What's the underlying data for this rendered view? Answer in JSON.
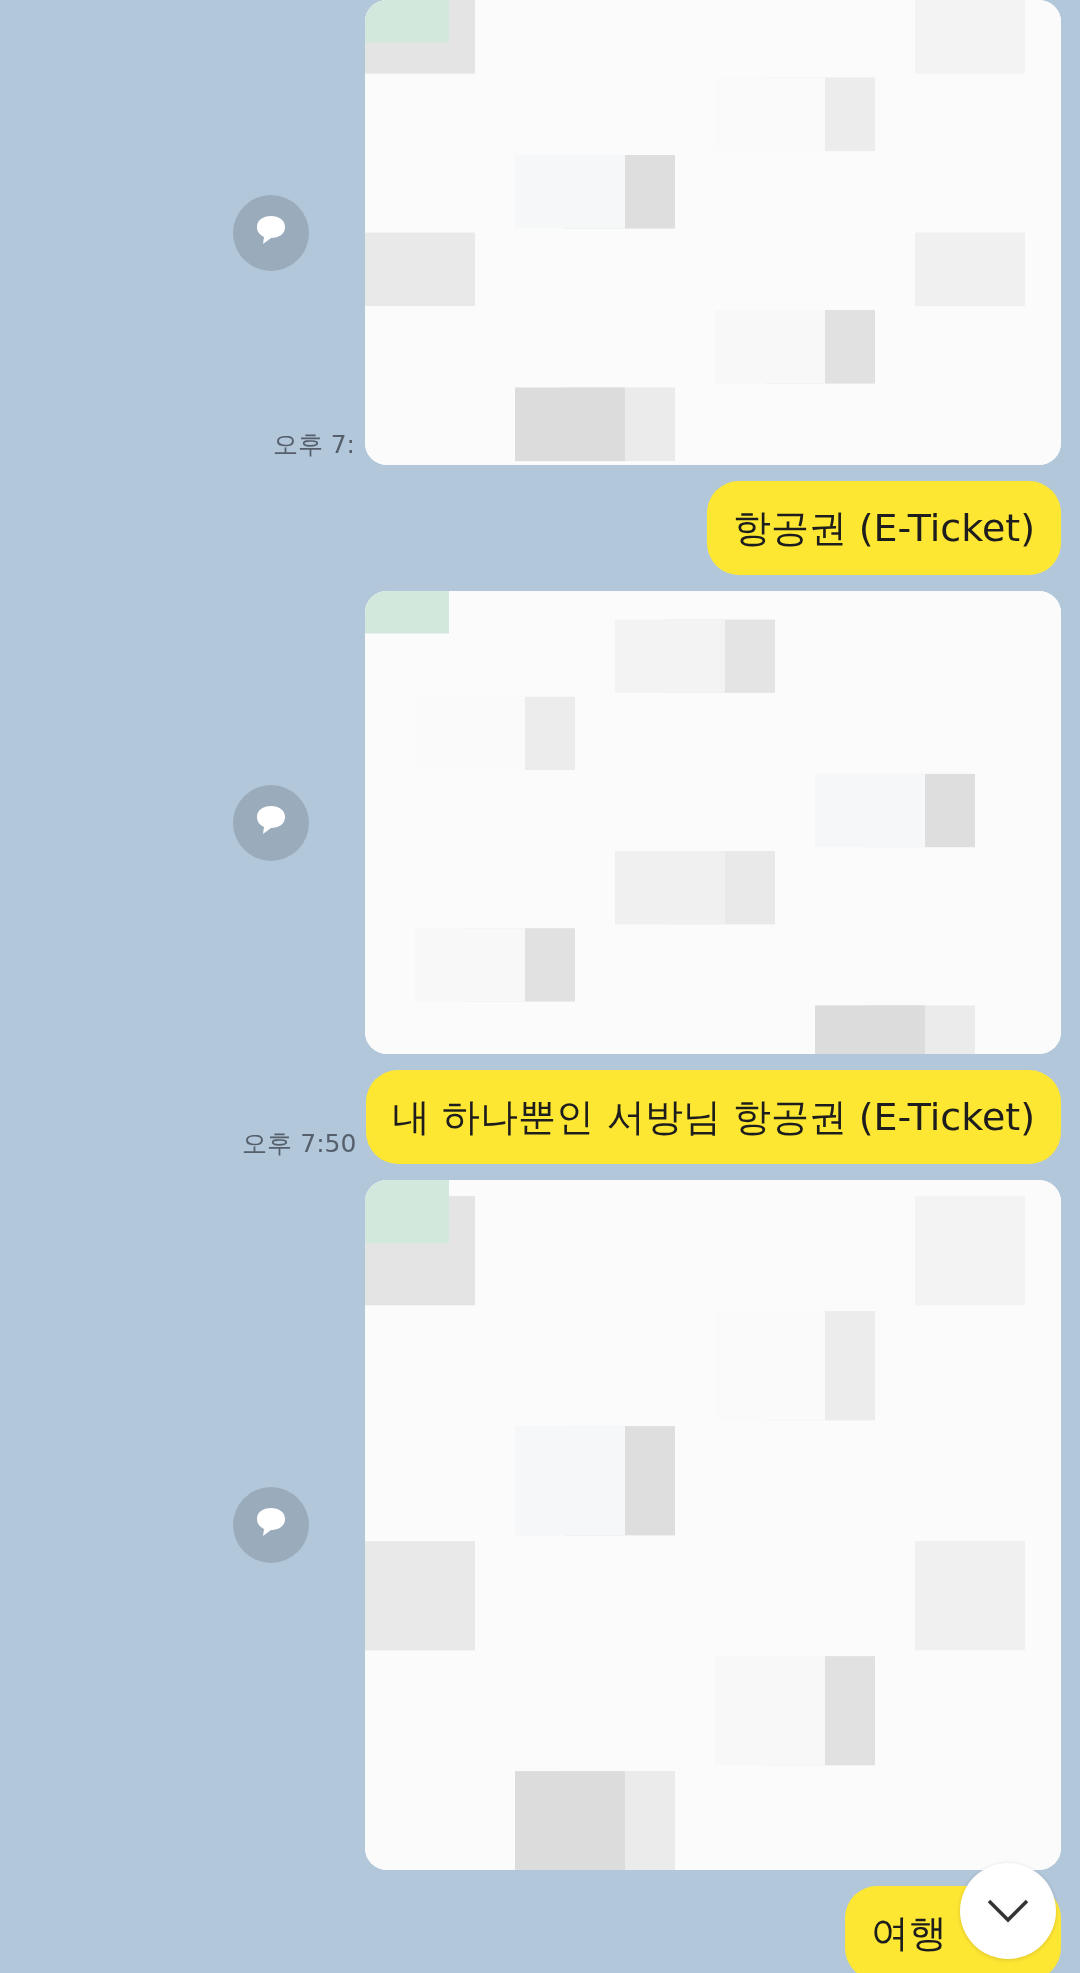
{
  "messages": [
    {
      "kind": "picture",
      "time": "오후 7:"
    },
    {
      "kind": "text",
      "text": "항공권 (E-Ticket)"
    },
    {
      "kind": "picture"
    },
    {
      "kind": "text",
      "text": "내 하나뿐인 서방님 항공권 (E-Ticket)",
      "time": "오후 7:50"
    },
    {
      "kind": "picture"
    },
    {
      "kind": "text",
      "text": "여행"
    }
  ]
}
